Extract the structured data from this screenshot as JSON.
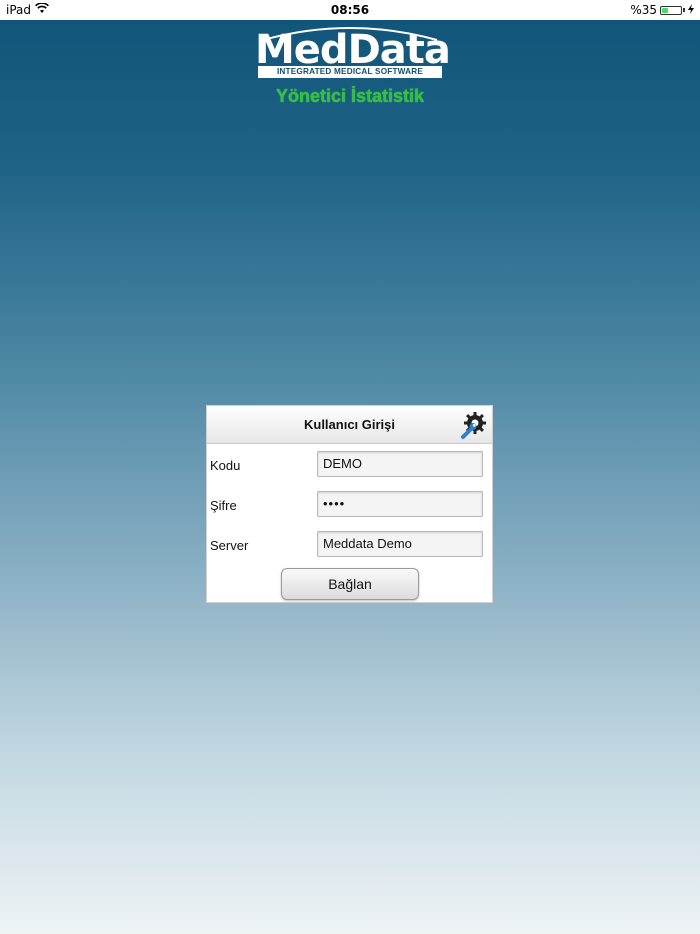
{
  "status_bar": {
    "device": "iPad",
    "time": "08:56",
    "battery_text": "%35",
    "battery_level": 0.35,
    "icons": [
      "wifi-icon",
      "battery-icon",
      "charging-icon"
    ]
  },
  "logo": {
    "name": "MedData",
    "tagline": "INTEGRATED MEDICAL SOFTWARE"
  },
  "app_title": "Yönetici İstatistik",
  "login": {
    "title": "Kullanıcı Girişi",
    "settings_icon": "settings-wrench-gear-icon",
    "fields": {
      "code_label": "Kodu",
      "code_value": "DEMO",
      "password_label": "Şifre",
      "password_value": "••••",
      "server_label": "Server",
      "server_value": "Meddata Demo"
    },
    "connect_label": "Bağlan"
  },
  "colors": {
    "title_green": "#34c23a",
    "gradient_top": "#0f5478",
    "gradient_bottom": "#eef3f5"
  }
}
